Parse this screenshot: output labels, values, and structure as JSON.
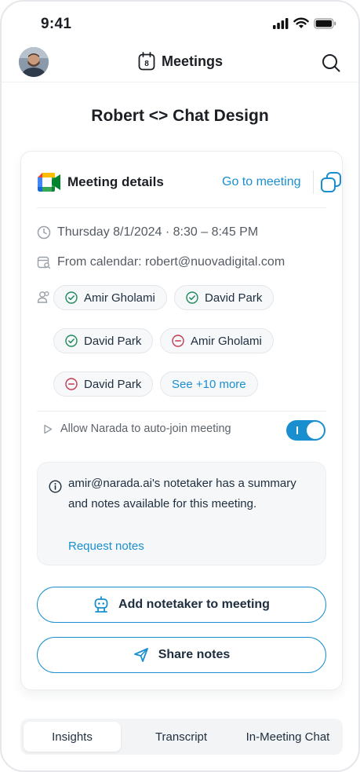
{
  "status_bar": {
    "time": "9:41"
  },
  "header": {
    "title": "Meetings",
    "calendar_day": "8"
  },
  "page_title": "Robert <> Chat Design",
  "card": {
    "title": "Meeting details",
    "go_to_meeting": "Go to meeting",
    "datetime": "Thursday 8/1/2024 · 8:30 – 8:45 PM",
    "calendar": "From calendar: robert@nuovadigital.com",
    "attendees": [
      {
        "name": "Amir Gholami",
        "status": "accepted"
      },
      {
        "name": "David Park",
        "status": "accepted"
      },
      {
        "name": "David Park",
        "status": "accepted"
      },
      {
        "name": "Amir Gholami",
        "status": "declined"
      },
      {
        "name": "David Park",
        "status": "declined"
      }
    ],
    "see_more": "See +10 more",
    "auto_join_label": "Allow Narada to auto-join meeting",
    "auto_join_enabled": true,
    "notice": {
      "message": "amir@narada.ai's notetaker has a summary and notes available for this meeting.",
      "link": "Request notes"
    },
    "add_notetaker": "Add notetaker to meeting",
    "share_notes": "Share notes"
  },
  "tabs": [
    {
      "label": "Insights",
      "active": true
    },
    {
      "label": "Transcript",
      "active": false
    },
    {
      "label": "In-Meeting Chat",
      "active": false
    }
  ],
  "colors": {
    "accent": "#1a8fd0",
    "accepted": "#1f8a5b",
    "declined": "#c23a4f"
  }
}
